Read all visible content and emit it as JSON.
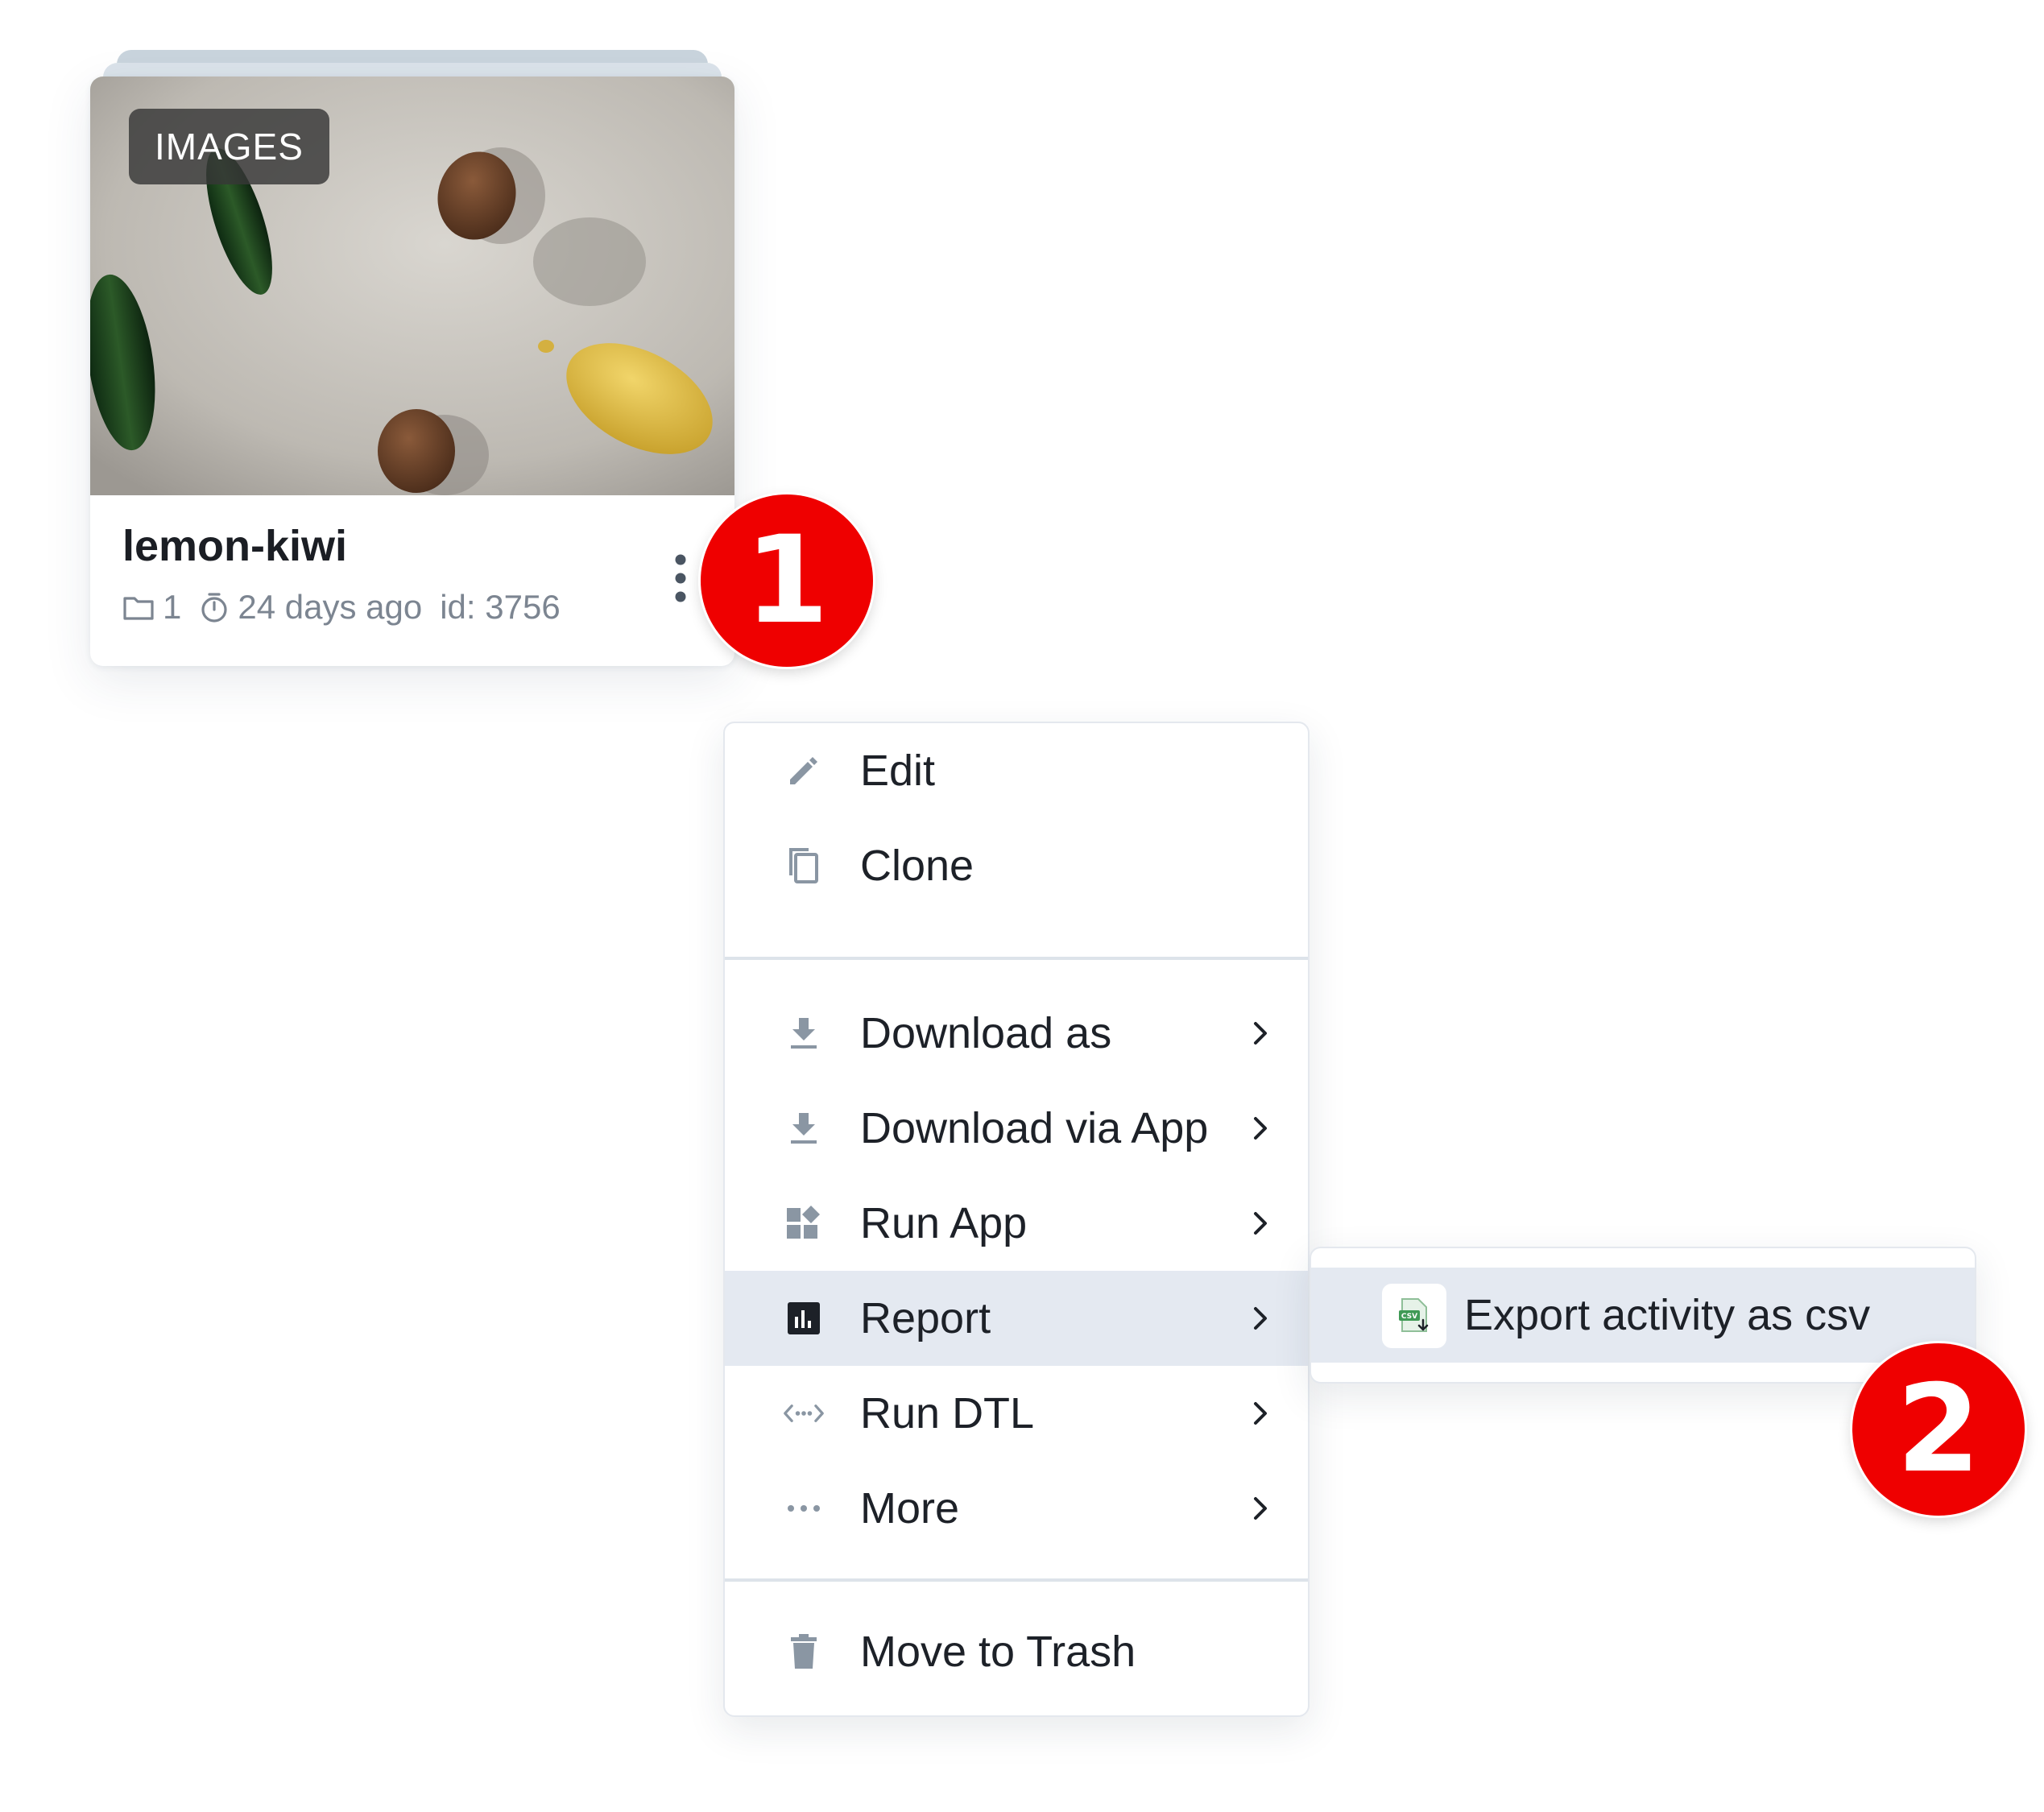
{
  "card": {
    "type_badge": "IMAGES",
    "title": "lemon-kiwi",
    "dataset_count": "1",
    "updated": "24 days ago",
    "id_text": "id: 3756",
    "icons": {
      "dataset": "folder-icon",
      "updated": "stopwatch-icon",
      "actions": "kebab-menu-icon"
    }
  },
  "steps": [
    "1",
    "2"
  ],
  "menu": {
    "items": [
      {
        "label": "Edit",
        "icon": "pencil-icon",
        "has_submenu": false
      },
      {
        "label": "Clone",
        "icon": "copy-icon",
        "has_submenu": false
      },
      {
        "label": "Download as",
        "icon": "download-icon",
        "has_submenu": true
      },
      {
        "label": "Download via App",
        "icon": "download-icon",
        "has_submenu": true
      },
      {
        "label": "Run App",
        "icon": "apps-icon",
        "has_submenu": true
      },
      {
        "label": "Report",
        "icon": "report-chart-icon",
        "has_submenu": true,
        "active": true
      },
      {
        "label": "Run DTL",
        "icon": "code-arrows-icon",
        "has_submenu": true
      },
      {
        "label": "More",
        "icon": "ellipsis-icon",
        "has_submenu": true
      },
      {
        "label": "Move to Trash",
        "icon": "trash-icon",
        "has_submenu": false
      }
    ]
  },
  "submenu": {
    "items": [
      {
        "label": "Export activity as csv",
        "icon": "csv-file-icon",
        "active": true
      }
    ]
  },
  "colors": {
    "step_badge": "#ef0000",
    "active_row": "#e4e9f1",
    "icon_gray": "#8a96a3",
    "text": "#1d2128",
    "meta_text": "#7c8591"
  }
}
